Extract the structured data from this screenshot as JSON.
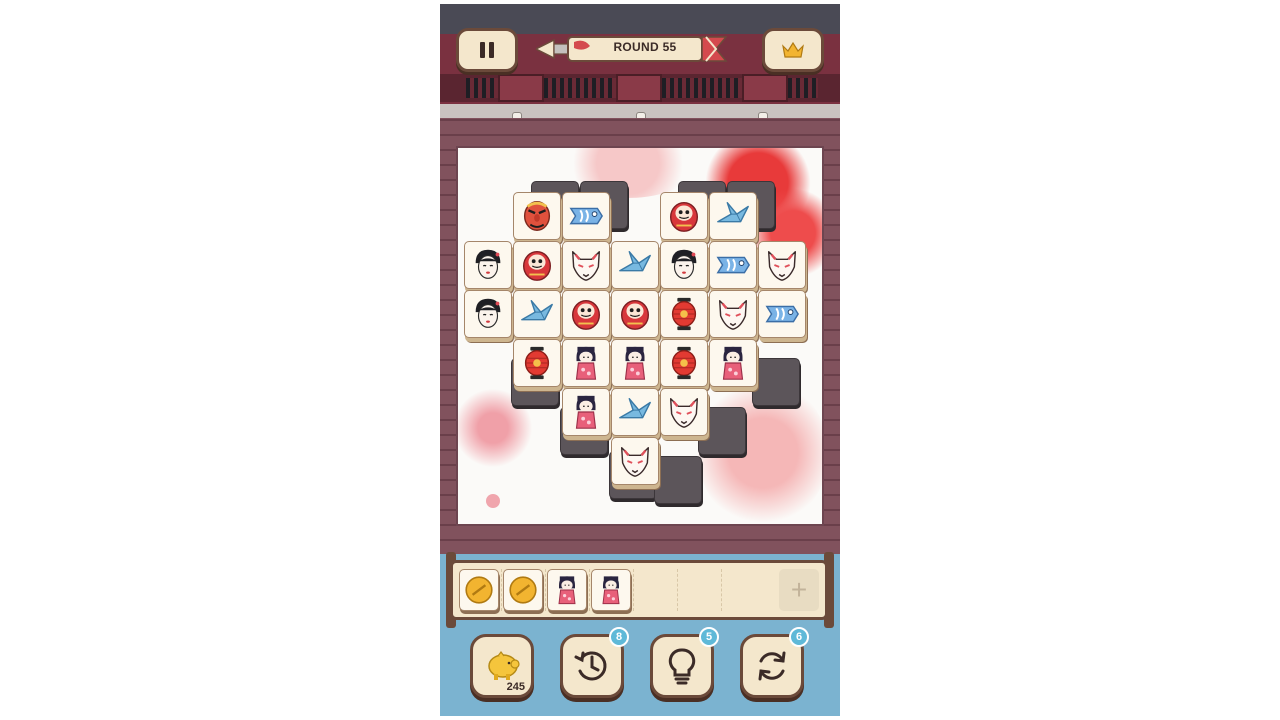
{
  "hud": {
    "round_label": "ROUND 55",
    "pause_icon": "pause-icon",
    "crown_icon": "crown-icon"
  },
  "board": {
    "layout": "heart",
    "tiles": [
      [
        "",
        "tengu",
        "koinobori",
        "",
        "daruma",
        "crane",
        ""
      ],
      [
        "geisha",
        "daruma",
        "fox",
        "crane",
        "geisha",
        "koinobori",
        "fox"
      ],
      [
        "geisha",
        "crane",
        "daruma",
        "daruma",
        "lantern",
        "fox",
        "koinobori"
      ],
      [
        "",
        "lantern",
        "kokeshi",
        "kokeshi",
        "lantern",
        "kokeshi",
        ""
      ],
      [
        "",
        "",
        "kokeshi",
        "crane",
        "fox",
        "",
        ""
      ],
      [
        "",
        "",
        "",
        "fox",
        "",
        "",
        ""
      ]
    ]
  },
  "tray": {
    "capacity": 7,
    "tiles": [
      "coin",
      "coin",
      "kokeshi",
      "kokeshi"
    ],
    "add_label": "+"
  },
  "powerups": {
    "coins": {
      "icon": "piggy-bank-icon",
      "count": "245"
    },
    "undo": {
      "icon": "undo-clock-icon",
      "badge": "8"
    },
    "hint": {
      "icon": "lightbulb-icon",
      "badge": "5"
    },
    "shuffle": {
      "icon": "shuffle-icon",
      "badge": "6"
    }
  },
  "colors": {
    "header": "#7a3140",
    "tile_face": "#fdf8ee",
    "water": "#7bb3d0",
    "badge": "#5fb9d8"
  }
}
